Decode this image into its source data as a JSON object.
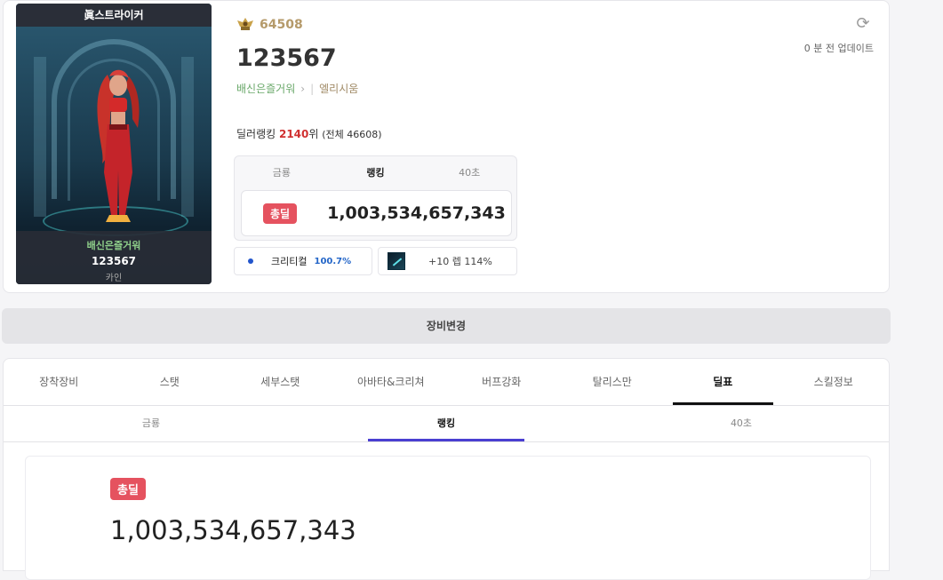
{
  "character": {
    "title": "眞스트라이커",
    "name": "123567",
    "guild": "배신은즐거워",
    "server": "엘리시움",
    "portrait_server": "카인",
    "fame": "64508",
    "fame_icon": "fame-crest-icon"
  },
  "ranking": {
    "label": "딜러랭킹 ",
    "rank": "2140",
    "rank_suffix": "위 ",
    "total": "(전체 46608)"
  },
  "update": {
    "text": "0 분 전 업데이트",
    "icon": "refresh-icon"
  },
  "deal_summary": {
    "tabs": [
      "금룡",
      "랭킹",
      "40초"
    ],
    "active_tab": 1,
    "badge": "총딜",
    "value": "1,003,534,657,343"
  },
  "stats": {
    "crit_label": "크리티컬",
    "crit_value": "100.7%",
    "item_text": "+10 렙 114%"
  },
  "equip_change_label": "장비변경",
  "main_tabs": [
    "장착장비",
    "스탯",
    "세부스탯",
    "아바타&크리쳐",
    "버프강화",
    "탈리스만",
    "딜표",
    "스킬정보"
  ],
  "main_active": 6,
  "sub_tabs": [
    "금룡",
    "랭킹",
    "40초"
  ],
  "sub_active": 1,
  "result": {
    "badge": "총딜",
    "value": "1,003,534,657,343"
  },
  "colors": {
    "badge": "#e5525f",
    "accent_underline": "#4a3fd1",
    "crit": "#2466c8",
    "guild": "#6aa86a"
  }
}
